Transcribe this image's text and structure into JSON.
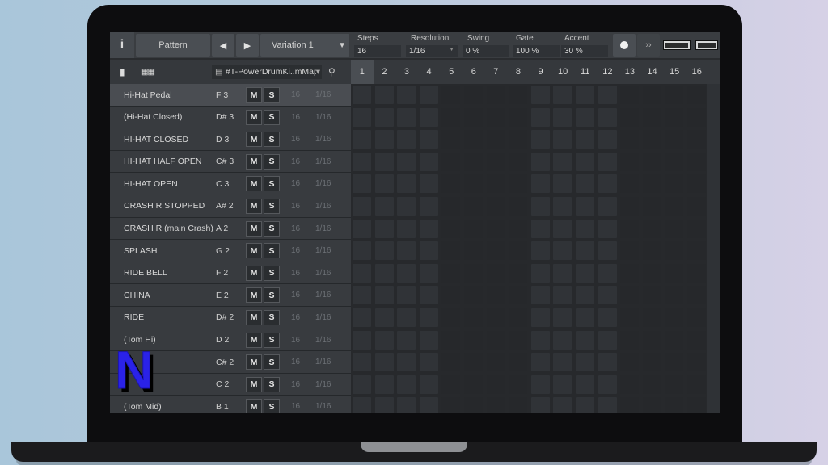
{
  "toolbar": {
    "info_label": "i",
    "pattern_label": "Pattern",
    "prev_arrow": "◀",
    "next_arrow": "▶",
    "variation_label": "Variation 1",
    "variation_dropdown": "▼",
    "steps_label": "Steps",
    "steps_value": "16",
    "resolution_label": "Resolution",
    "resolution_value": "1/16",
    "swing_label": "Swing",
    "swing_value": "0 %",
    "gate_label": "Gate",
    "gate_value": "100 %",
    "accent_label": "Accent",
    "accent_value": "30 %",
    "forward_label": "››"
  },
  "subbar": {
    "kit_name": "#T-PowerDrumKi..mMap",
    "kit_dropdown": "▾"
  },
  "steps": [
    "1",
    "2",
    "3",
    "4",
    "5",
    "6",
    "7",
    "8",
    "9",
    "10",
    "11",
    "12",
    "13",
    "14",
    "15",
    "16"
  ],
  "active_step": "1",
  "instruments": [
    {
      "name": "Hi-Hat Pedal",
      "note": "F 3",
      "steps": "16",
      "res": "1/16",
      "selected": true
    },
    {
      "name": "(Hi-Hat Closed)",
      "note": "D# 3",
      "steps": "16",
      "res": "1/16"
    },
    {
      "name": "HI-HAT CLOSED",
      "note": "D 3",
      "steps": "16",
      "res": "1/16"
    },
    {
      "name": "HI-HAT HALF OPEN",
      "note": "C# 3",
      "steps": "16",
      "res": "1/16"
    },
    {
      "name": "HI-HAT OPEN",
      "note": "C 3",
      "steps": "16",
      "res": "1/16"
    },
    {
      "name": "CRASH R STOPPED",
      "note": "A# 2",
      "steps": "16",
      "res": "1/16"
    },
    {
      "name": "CRASH R (main Crash)",
      "note": "A 2",
      "steps": "16",
      "res": "1/16"
    },
    {
      "name": "SPLASH",
      "note": "G 2",
      "steps": "16",
      "res": "1/16"
    },
    {
      "name": "RIDE BELL",
      "note": "F 2",
      "steps": "16",
      "res": "1/16"
    },
    {
      "name": "CHINA",
      "note": "E 2",
      "steps": "16",
      "res": "1/16"
    },
    {
      "name": "RIDE",
      "note": "D# 2",
      "steps": "16",
      "res": "1/16"
    },
    {
      "name": "(Tom Hi)",
      "note": "D 2",
      "steps": "16",
      "res": "1/16"
    },
    {
      "name": "",
      "note": "C# 2",
      "steps": "16",
      "res": "1/16"
    },
    {
      "name": "",
      "note": "C 2",
      "steps": "16",
      "res": "1/16"
    },
    {
      "name": "(Tom Mid)",
      "note": "B 1",
      "steps": "16",
      "res": "1/16"
    }
  ],
  "mute_label": "M",
  "solo_label": "S",
  "logo_letter": "N",
  "colors": {
    "logo_fill": "#2a22e8",
    "cell_light": "#303337",
    "cell_dark": "#26282b",
    "selected_row": "#4a4d52"
  }
}
